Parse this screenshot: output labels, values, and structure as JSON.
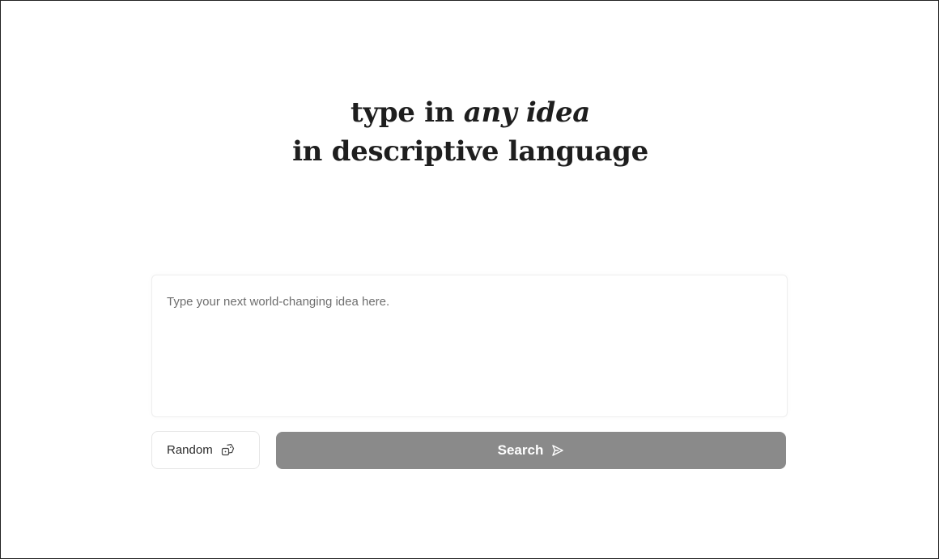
{
  "hero": {
    "line1_prefix": "type in ",
    "line1_emphasis": "any idea",
    "line2": "in descriptive language"
  },
  "prompt": {
    "placeholder": "Type your next world-changing idea here.",
    "value": ""
  },
  "actions": {
    "random_label": "Random",
    "random_icon": "dice-icon",
    "search_label": "Search",
    "search_icon": "send-icon"
  },
  "colors": {
    "search_button_bg": "#8a8a8a",
    "text_dark": "#1e1e1e"
  }
}
